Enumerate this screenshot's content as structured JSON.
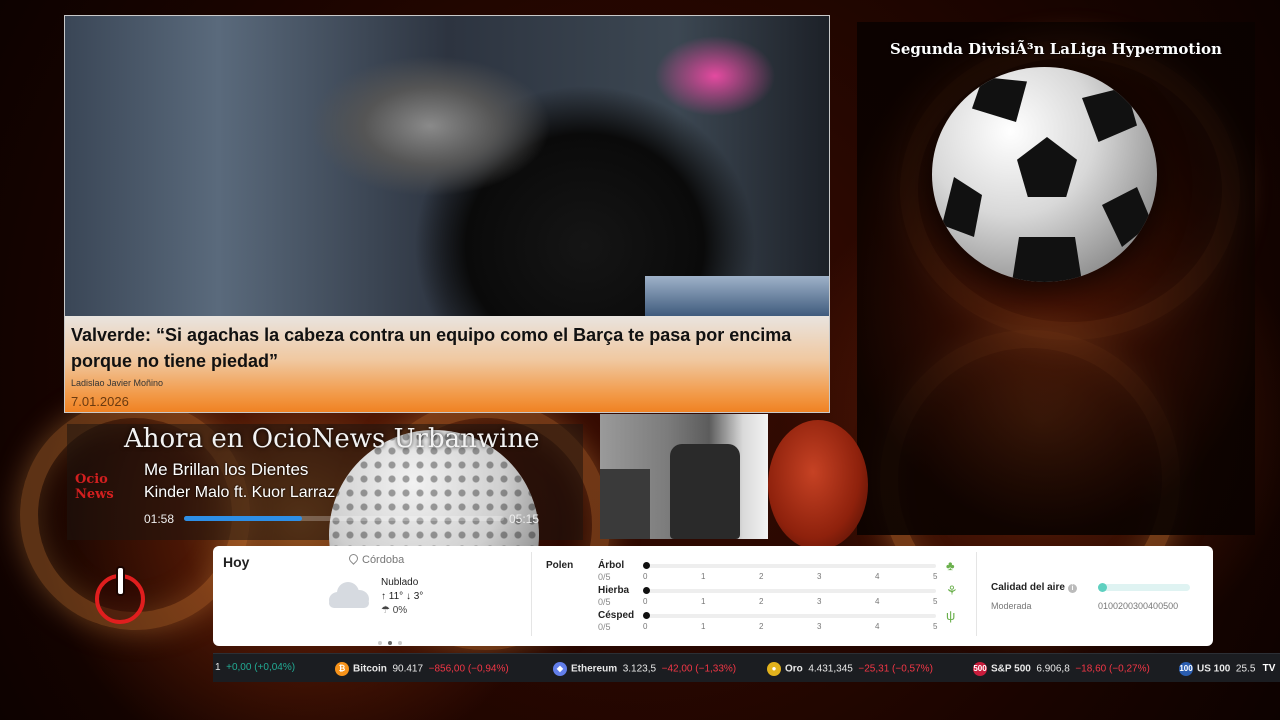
{
  "news": {
    "headline": "Valverde: “Si agachas la cabeza contra un equipo como el Barça te pasa por encima porque no tiene piedad”",
    "author": "Ladislao Javier Moñino",
    "date": "7.01.2026"
  },
  "league": {
    "title": "Segunda DivisiÃ³n LaLiga Hypermotion"
  },
  "player": {
    "heading": "Ahora en OcioNews Urbanwine",
    "logo_top": "Ocio",
    "logo_bottom": "News",
    "track_title": "Me Brillan los Dientes",
    "track_artist": "Kinder Malo ft. Kuor Larraz",
    "time_current": "01:58",
    "time_total": "05:15",
    "progress": 0.37
  },
  "weather": {
    "today_label": "Hoy",
    "location": "Córdoba",
    "condition": "Nublado",
    "temp_high": "11°",
    "temp_low": "3°",
    "rain": "0%",
    "pollen_label": "Polen",
    "pollen": [
      {
        "name": "Árbol",
        "value": "0/5",
        "icon": "tree-icon"
      },
      {
        "name": "Hierba",
        "value": "0/5",
        "icon": "grass-icon"
      },
      {
        "name": "Césped",
        "value": "0/5",
        "icon": "lawn-icon"
      }
    ],
    "pollen_ticks": [
      "0",
      "1",
      "2",
      "3",
      "4",
      "5"
    ],
    "air_quality_label": "Calidad del aire",
    "air_quality_value": "Moderada",
    "air_quality_scale": "0100200300400500"
  },
  "ticker": {
    "items": [
      {
        "name": "",
        "price": "1",
        "change": "+0,00 (+0,04%)",
        "direction": "up",
        "icon_text": "",
        "color": "#22ab94"
      },
      {
        "name": "Bitcoin",
        "price": "90.417",
        "change": "−856,00 (−0,94%)",
        "direction": "down",
        "icon_text": "₿",
        "color": "#f7931a"
      },
      {
        "name": "Ethereum",
        "price": "3.123,5",
        "change": "−42,00 (−1,33%)",
        "direction": "down",
        "icon_text": "◆",
        "color": "#627eea"
      },
      {
        "name": "Oro",
        "price": "4.431,345",
        "change": "−25,31 (−0,57%)",
        "direction": "down",
        "icon_text": "●",
        "color": "#e2b21c"
      },
      {
        "name": "S&P 500",
        "price": "6.906,8",
        "change": "−18,60 (−0,27%)",
        "direction": "down",
        "icon_text": "500",
        "color": "#c91c3c"
      },
      {
        "name": "US 100",
        "price": "25.5",
        "change": "",
        "direction": "up",
        "icon_text": "100",
        "color": "#2a5db0"
      }
    ],
    "brand": "TV"
  }
}
